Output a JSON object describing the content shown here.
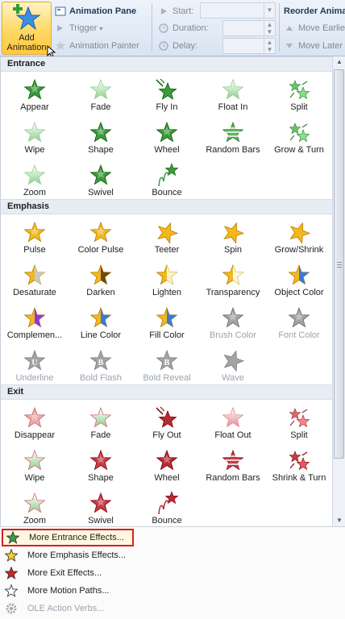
{
  "ribbon": {
    "add_animation_label_1": "Add",
    "add_animation_label_2": "Animation",
    "animation_pane": "Animation Pane",
    "trigger": "Trigger",
    "animation_painter": "Animation Painter",
    "start": "Start:",
    "duration": "Duration:",
    "delay": "Delay:",
    "reorder": "Reorder Anima",
    "move_earlier": "Move Earlie",
    "move_later": "Move Later"
  },
  "sections": [
    {
      "title": "Entrance",
      "items": [
        {
          "label": "Appear",
          "color": "#3e9a3e",
          "style": "plain",
          "enabled": true
        },
        {
          "label": "Fade",
          "color": "#8fcf8f",
          "style": "fade",
          "enabled": true
        },
        {
          "label": "Fly In",
          "color": "#3e9a3e",
          "style": "fly",
          "enabled": true
        },
        {
          "label": "Float In",
          "color": "#8fcf8f",
          "style": "float",
          "enabled": true
        },
        {
          "label": "Split",
          "color": "#6cbf6c",
          "style": "split",
          "enabled": true
        },
        {
          "label": "Wipe",
          "color": "#8fcf8f",
          "style": "wipe",
          "enabled": true
        },
        {
          "label": "Shape",
          "color": "#3e9a3e",
          "style": "shape",
          "enabled": true
        },
        {
          "label": "Wheel",
          "color": "#3e9a3e",
          "style": "wheel",
          "enabled": true
        },
        {
          "label": "Random Bars",
          "color": "#5fb35f",
          "style": "bars",
          "enabled": true
        },
        {
          "label": "Grow & Turn",
          "color": "#6cbf6c",
          "style": "turn",
          "enabled": true
        },
        {
          "label": "Zoom",
          "color": "#8fcf8f",
          "style": "zoom",
          "enabled": true
        },
        {
          "label": "Swivel",
          "color": "#3e9a3e",
          "style": "swivel",
          "enabled": true
        },
        {
          "label": "Bounce",
          "color": "#3e9a3e",
          "style": "bounce",
          "enabled": true
        }
      ]
    },
    {
      "title": "Emphasis",
      "items": [
        {
          "label": "Pulse",
          "color": "#f2b81e",
          "style": "pulse",
          "enabled": true
        },
        {
          "label": "Color Pulse",
          "color": "#f2b81e",
          "style": "colorpulse",
          "enabled": true
        },
        {
          "label": "Teeter",
          "color": "#f2b81e",
          "style": "teeter",
          "enabled": true
        },
        {
          "label": "Spin",
          "color": "#f2b81e",
          "style": "spin",
          "enabled": true
        },
        {
          "label": "Grow/Shrink",
          "color": "#f2b81e",
          "style": "grow",
          "enabled": true
        },
        {
          "label": "Desaturate",
          "color": "#f2b81e",
          "style": "desat",
          "enabled": true
        },
        {
          "label": "Darken",
          "color": "#f2b81e",
          "style": "darken",
          "enabled": true
        },
        {
          "label": "Lighten",
          "color": "#f2b81e",
          "style": "lighten",
          "enabled": true
        },
        {
          "label": "Transparency",
          "color": "#f2b81e",
          "style": "transp",
          "enabled": true
        },
        {
          "label": "Object Color",
          "color": "#f2b81e",
          "style": "objcolor",
          "enabled": true
        },
        {
          "label": "Complemen...",
          "color": "#f2b81e",
          "style": "compl",
          "enabled": true
        },
        {
          "label": "Line Color",
          "color": "#f2b81e",
          "style": "linecolor",
          "enabled": true
        },
        {
          "label": "Fill Color",
          "color": "#f2b81e",
          "style": "fillcolor",
          "enabled": true
        },
        {
          "label": "Brush Color",
          "color": "#a3a3a3",
          "style": "brush",
          "enabled": false
        },
        {
          "label": "Font Color",
          "color": "#a3a3a3",
          "style": "fontcolor",
          "enabled": false
        },
        {
          "label": "Underline",
          "color": "#a3a3a3",
          "style": "underline",
          "enabled": false
        },
        {
          "label": "Bold Flash",
          "color": "#a3a3a3",
          "style": "boldflash",
          "enabled": false
        },
        {
          "label": "Bold Reveal",
          "color": "#a3a3a3",
          "style": "boldreveal",
          "enabled": false
        },
        {
          "label": "Wave",
          "color": "#a3a3a3",
          "style": "wave",
          "enabled": false
        }
      ]
    },
    {
      "title": "Exit",
      "items": [
        {
          "label": "Disappear",
          "color": "#f0a8a8",
          "style": "plain",
          "enabled": true
        },
        {
          "label": "Fade",
          "color": "#d9676d",
          "style": "fade",
          "enabled": true
        },
        {
          "label": "Fly Out",
          "color": "#b82a35",
          "style": "fly",
          "enabled": true
        },
        {
          "label": "Float Out",
          "color": "#e38a8f",
          "style": "float",
          "enabled": true
        },
        {
          "label": "Split",
          "color": "#d9676d",
          "style": "split",
          "enabled": true
        },
        {
          "label": "Wipe",
          "color": "#d9676d",
          "style": "wipe",
          "enabled": true
        },
        {
          "label": "Shape",
          "color": "#c53d47",
          "style": "shape",
          "enabled": true
        },
        {
          "label": "Wheel",
          "color": "#b82a35",
          "style": "wheel",
          "enabled": true
        },
        {
          "label": "Random Bars",
          "color": "#c53d47",
          "style": "bars",
          "enabled": true
        },
        {
          "label": "Shrink & Turn",
          "color": "#c53d47",
          "style": "turn",
          "enabled": true
        },
        {
          "label": "Zoom",
          "color": "#d9676d",
          "style": "zoom",
          "enabled": true
        },
        {
          "label": "Swivel",
          "color": "#c53d47",
          "style": "swivel",
          "enabled": true
        },
        {
          "label": "Bounce",
          "color": "#b82a35",
          "style": "bounce",
          "enabled": true
        }
      ]
    }
  ],
  "menu": [
    {
      "label": "More Entrance Effects...",
      "icon": "green-star-icon",
      "color": "#3e9a3e",
      "enabled": true,
      "highlighted": true
    },
    {
      "label": "More Emphasis Effects...",
      "icon": "yellow-star-icon",
      "color": "#f2d21e",
      "enabled": true,
      "highlighted": false
    },
    {
      "label": "More Exit Effects...",
      "icon": "red-star-icon",
      "color": "#d62020",
      "enabled": true,
      "highlighted": false
    },
    {
      "label": "More Motion Paths...",
      "icon": "outline-star-icon",
      "color": "#ffffff",
      "enabled": true,
      "highlighted": false
    },
    {
      "label": "OLE Action Verbs...",
      "icon": "gear-icon",
      "color": "#a3a3a3",
      "enabled": false,
      "highlighted": false
    }
  ]
}
